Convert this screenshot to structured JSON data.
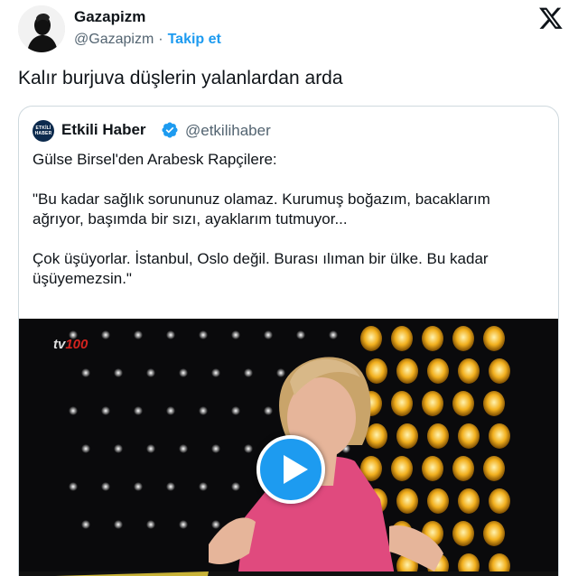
{
  "author": {
    "name": "Gazapizm",
    "handle": "@Gazapizm",
    "separator": "·",
    "follow_label": "Takip et"
  },
  "tweet": {
    "text": "Kalır burjuva düşlerin yalanlardan arda"
  },
  "quote": {
    "avatar_text": "ETKİLİ HABER",
    "name": "Etkili Haber",
    "handle": "@etkilihaber",
    "lines": [
      "Gülse Birsel'den Arabesk Rapçilere:",
      "\"Bu kadar sağlık sorununuz olamaz. Kurumuş boğazım, bacaklarım",
      "ağrıyor, başımda bir sızı, ayaklarım tutmuyor...",
      "Çok üşüyorlar. İstanbul, Oslo değil. Burası ılıman bir ülke. Bu kadar",
      "üşüyemezsin.\""
    ]
  },
  "media": {
    "channel_prefix": "tv",
    "channel_number": "100"
  },
  "icons": {
    "platform": "x-logo-icon",
    "verified": "verified-badge-icon",
    "play": "play-icon"
  },
  "colors": {
    "accent": "#1d9bf0",
    "text": "#0f1419",
    "secondary": "#536471",
    "border": "#cfd9de"
  }
}
